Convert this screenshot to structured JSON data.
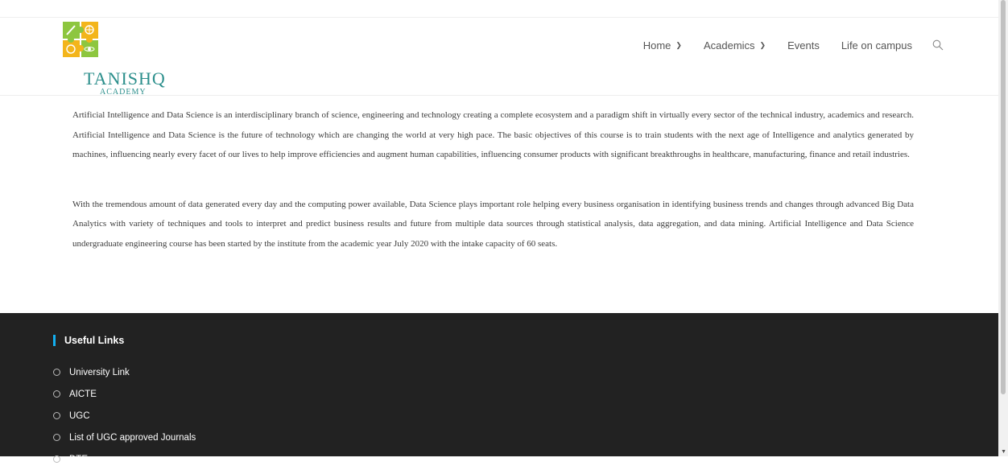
{
  "brand": {
    "name": "TANISHQ",
    "subtitle": "ACADEMY",
    "colors": {
      "green": "#8dc63f",
      "yellow": "#f3b51b",
      "teal": "#2c8f8c"
    }
  },
  "nav": {
    "items": [
      {
        "label": "Home",
        "has_dropdown": true
      },
      {
        "label": "Academics",
        "has_dropdown": true
      },
      {
        "label": "Events",
        "has_dropdown": false
      },
      {
        "label": "Life on campus",
        "has_dropdown": false
      }
    ],
    "search_icon": "search-icon"
  },
  "content": {
    "paragraphs": [
      "Artificial Intelligence and Data Science is an interdisciplinary branch of science, engineering and technology creating a complete ecosystem and a paradigm shift in virtually every sector of the technical industry, academics and research. Artificial Intelligence and Data Science is the future of technology which are changing the world at very high pace. The basic objectives of this course is to train students with the next age of Intelligence and analytics generated by machines, influencing nearly every facet of our lives to help improve efficiencies and augment human capabilities, influencing consumer products with significant breakthroughs in healthcare, manufacturing, finance and retail industries.",
      "With the tremendous amount of data generated every day and the computing power available, Data Science plays important role helping every business organisation in identifying business trends and changes through advanced Big Data Analytics with variety of techniques and tools to interpret and predict business results and future from multiple data sources through statistical analysis, data aggregation, and data mining. Artificial Intelligence and Data Science undergraduate engineering course has been started by the institute from the academic year July 2020 with the intake capacity of 60 seats."
    ]
  },
  "footer": {
    "title": "Useful Links",
    "accent": "#13aff0",
    "links": [
      "University Link",
      "AICTE",
      "UGC",
      "List of UGC approved Journals",
      "DTE"
    ]
  }
}
